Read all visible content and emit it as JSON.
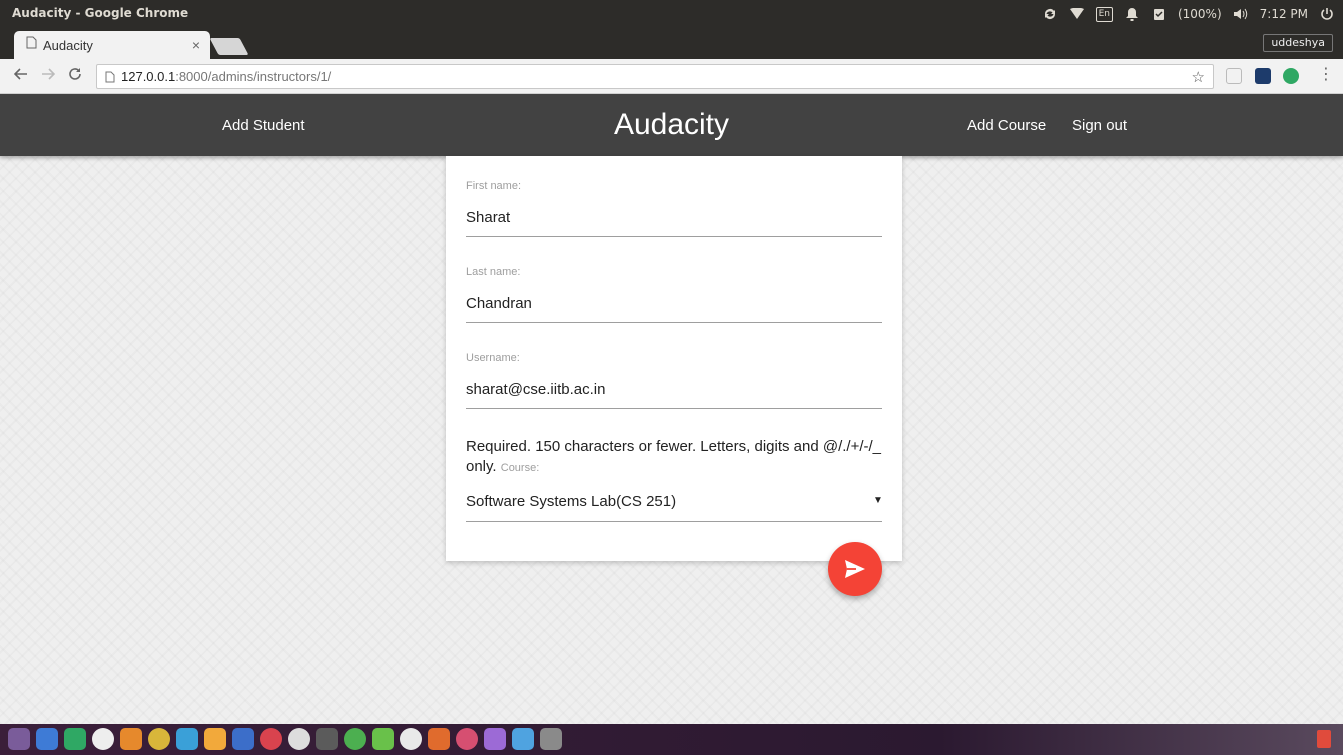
{
  "window": {
    "title": "Audacity - Google Chrome"
  },
  "tray": {
    "keyboard_layout": "En",
    "battery": "(100%)",
    "clock": "7:12 PM"
  },
  "browser": {
    "tab_title": "Audacity",
    "tab_close": "×",
    "profile_name": "uddeshya",
    "url_host": "127.0.0.1",
    "url_rest": ":8000/admins/instructors/1/"
  },
  "nav": {
    "add_student": "Add Student",
    "brand": "Audacity",
    "add_course": "Add Course",
    "sign_out": "Sign out"
  },
  "form": {
    "first_name": {
      "label": "First name:",
      "value": "Sharat"
    },
    "last_name": {
      "label": "Last name:",
      "value": "Chandran"
    },
    "username": {
      "label": "Username:",
      "value": "sharat@cse.iitb.ac.in"
    },
    "username_help": "Required. 150 characters or fewer. Letters, digits and @/./+/-/_ only.",
    "course": {
      "label": "Course:",
      "value": "Software Systems Lab(CS 251)"
    }
  },
  "colors": {
    "app_bar": "#424242",
    "fab": "#f44336",
    "page_bg": "#efefef"
  },
  "icons": {
    "tab": "page-icon",
    "back": "arrow-left-icon",
    "forward": "arrow-right-icon",
    "reload": "reload-icon",
    "bookmark": "star-icon",
    "submit": "send-icon",
    "select": "caret-down-icon"
  }
}
